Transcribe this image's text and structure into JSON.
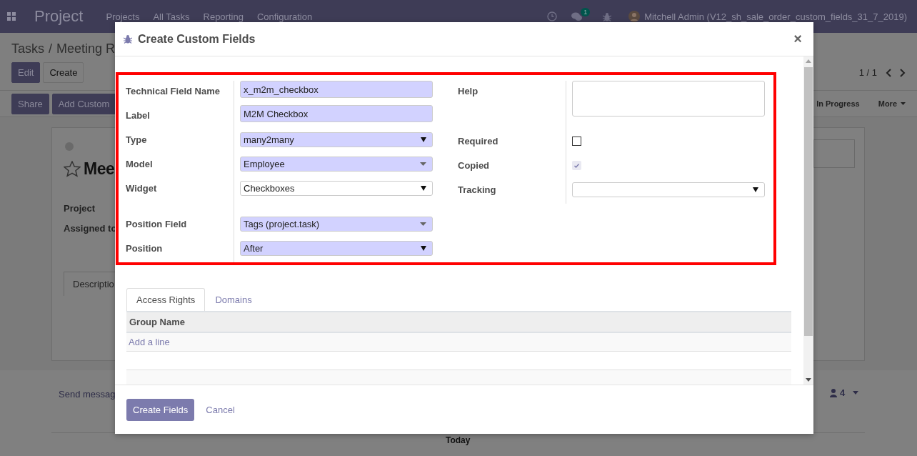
{
  "navbar": {
    "app_name": "Project",
    "menu": [
      "Projects",
      "All Tasks",
      "Reporting",
      "Configuration"
    ],
    "chat_badge": "1",
    "user": "Mitchell Admin (V12_sh_sale_order_custom_fields_31_7_2019)"
  },
  "breadcrumb": {
    "parent": "Tasks",
    "separator": "/",
    "current": "Meeting R"
  },
  "buttons": [
    "Edit",
    "Create"
  ],
  "pager": "1 / 1",
  "action_buttons": [
    "Share",
    "Add Custom"
  ],
  "stages": [
    {
      "label": "In Progress",
      "kind": "stage"
    },
    {
      "label": "More",
      "kind": "dropdown"
    }
  ],
  "record": {
    "title": "Mee",
    "fields": [
      "Project",
      "Assigned to"
    ],
    "tab": "Descriptio"
  },
  "chatter": {
    "send": "Send messag",
    "followers": "4",
    "date": "Today"
  },
  "dialog": {
    "title": "Create Custom Fields",
    "close": "×",
    "fields": [
      {
        "label": "Technical Field Name",
        "kind": "text",
        "value": "x_m2m_checkbox",
        "required": true
      },
      {
        "label": "Label",
        "kind": "text",
        "value": "M2M Checkbox",
        "required": true
      },
      {
        "label": "Type",
        "kind": "select",
        "value": "many2many",
        "required": true
      },
      {
        "label": "Model",
        "kind": "many2one",
        "value": "Employee",
        "required": true
      },
      {
        "label": "Widget",
        "kind": "select",
        "value": "Checkboxes",
        "required": false
      }
    ],
    "position_fields": [
      {
        "label": "Position Field",
        "kind": "many2one",
        "value": "Tags (project.task)",
        "required": true
      },
      {
        "label": "Position",
        "kind": "select",
        "value": "After",
        "required": true
      }
    ],
    "side_fields": [
      {
        "label": "Help",
        "kind": "textarea",
        "required": false
      },
      {
        "label": "Required",
        "kind": "checkbox",
        "checked": false,
        "disabled": false
      },
      {
        "label": "Copied",
        "kind": "checkbox",
        "checked": true,
        "disabled": true
      },
      {
        "label": "Tracking",
        "kind": "select",
        "required": false
      }
    ],
    "tabs": [
      {
        "label": "Access Rights",
        "selected": true
      },
      {
        "label": "Domains",
        "selected": false
      }
    ],
    "table": {
      "columns": [
        "Group Name"
      ],
      "add_line": "Add a line"
    },
    "primary_button": "Create Fields",
    "cancel": "Cancel"
  }
}
